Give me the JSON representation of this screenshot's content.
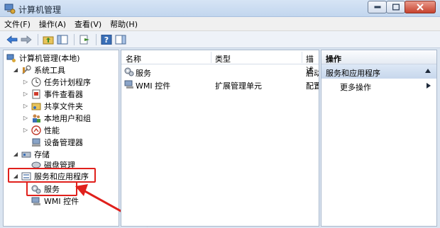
{
  "window": {
    "title": "计算机管理"
  },
  "menu": [
    "文件(F)",
    "操作(A)",
    "查看(V)",
    "帮助(H)"
  ],
  "tree": {
    "root": "计算机管理(本地)",
    "system_tools": "系统工具",
    "task_scheduler": "任务计划程序",
    "event_viewer": "事件查看器",
    "shared_folders": "共享文件夹",
    "local_users": "本地用户和组",
    "performance": "性能",
    "device_manager": "设备管理器",
    "storage": "存储",
    "disk_mgmt": "磁盘管理",
    "services_apps": "服务和应用程序",
    "services": "服务",
    "wmi": "WMI 控件"
  },
  "list": {
    "columns": [
      "名称",
      "类型",
      "描述"
    ],
    "rows": [
      {
        "name": "服务",
        "type": "",
        "desc": "启动"
      },
      {
        "name": "WMI 控件",
        "type": "扩展管理单元",
        "desc": "配置"
      }
    ]
  },
  "actions": {
    "header": "操作",
    "section": "服务和应用程序",
    "item": "更多操作"
  },
  "colors": {
    "highlight": "#e0201c",
    "accent": "#3a6fb7"
  }
}
